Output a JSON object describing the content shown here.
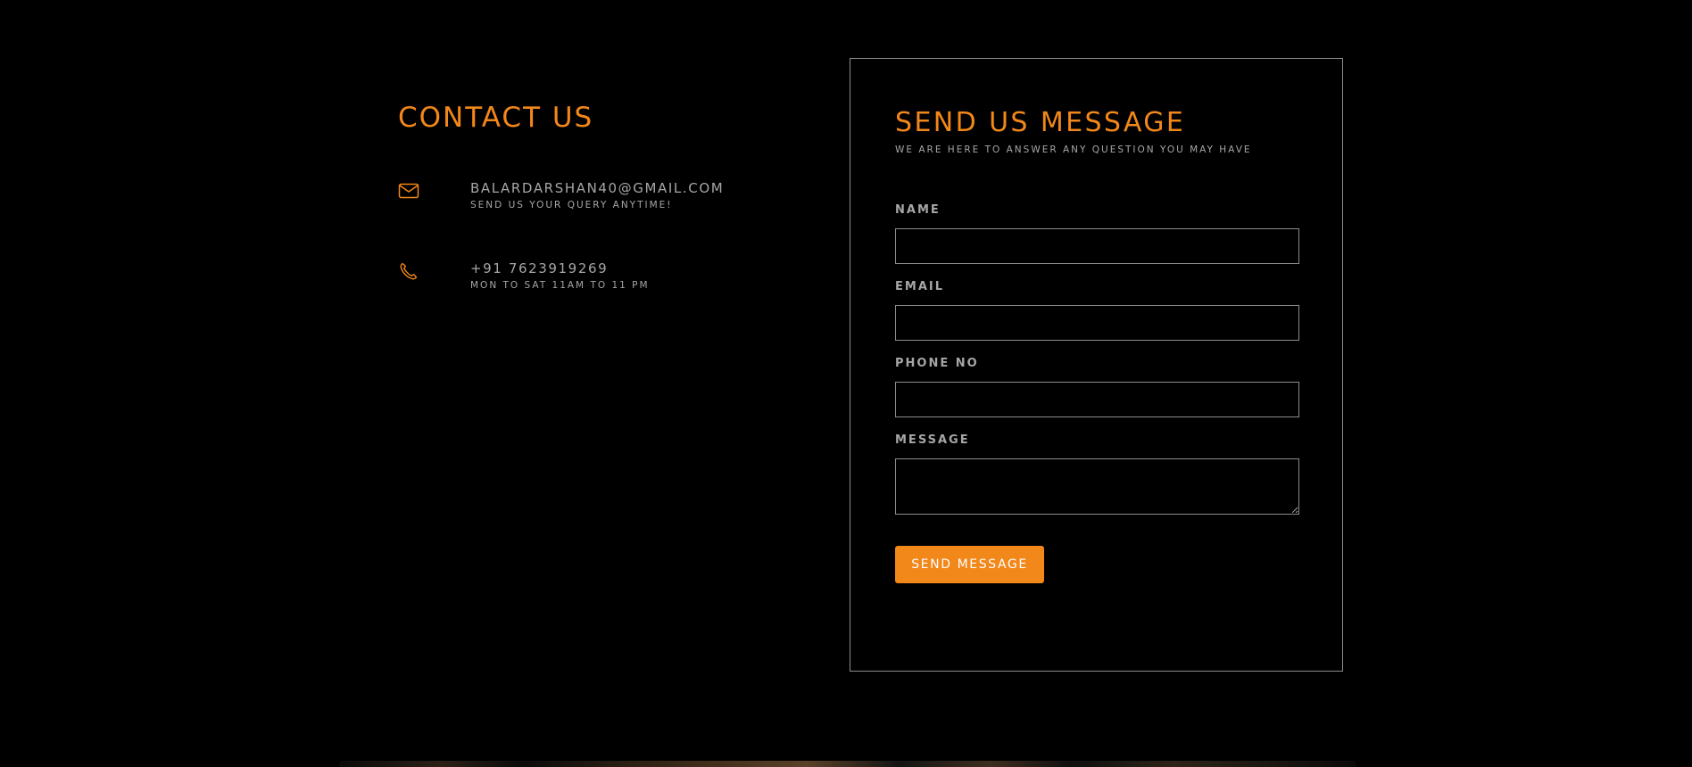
{
  "contact": {
    "title": "CONTACT US",
    "email": {
      "icon": "envelope-icon",
      "value": "BALARDARSHAN40@GMAIL.COM",
      "note": "SEND US YOUR QUERY ANYTIME!"
    },
    "phone": {
      "icon": "phone-icon",
      "value": "+91 7623919269",
      "note": "MON TO SAT 11AM TO 11 PM"
    }
  },
  "form": {
    "title": "SEND US MESSAGE",
    "subtitle": "WE ARE HERE TO ANSWER ANY QUESTION YOU MAY HAVE",
    "fields": {
      "name": {
        "label": "NAME",
        "value": ""
      },
      "email": {
        "label": "EMAIL",
        "value": ""
      },
      "phone": {
        "label": "PHONE NO",
        "value": ""
      },
      "message": {
        "label": "MESSAGE",
        "value": ""
      }
    },
    "submit_label": "SEND MESSAGE"
  },
  "colors": {
    "accent": "#f2871a",
    "background": "#000000",
    "text_muted": "#a6a6a6",
    "border": "#8d8d8d"
  }
}
